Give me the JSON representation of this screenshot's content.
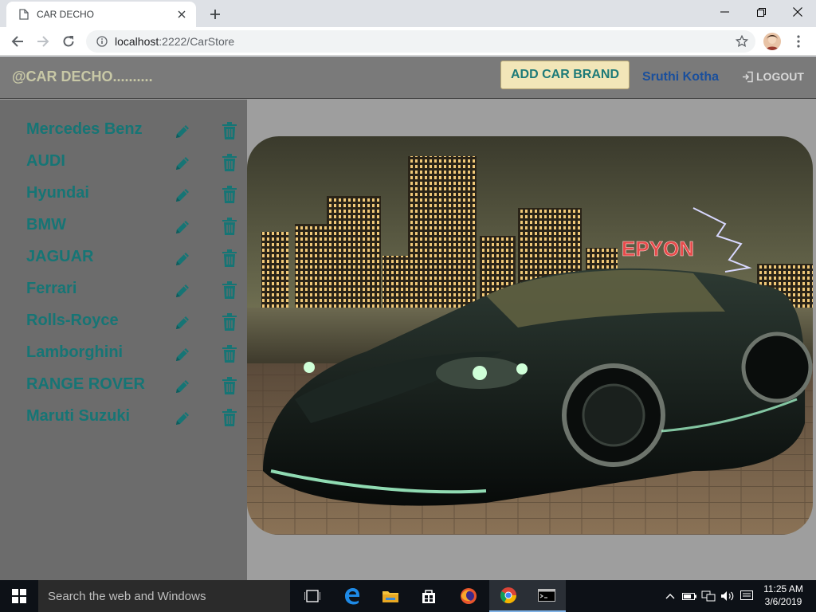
{
  "browser": {
    "tab_title": "CAR DECHO",
    "url_host": "localhost",
    "url_path": ":2222/CarStore"
  },
  "app": {
    "brand": "@CAR DECHO..........",
    "add_button": "ADD CAR BRAND",
    "user_name": "Sruthi Kotha",
    "logout_label": "LOGOUT",
    "car_brands": [
      "Mercedes Benz",
      "AUDI",
      "Hyundai",
      "BMW",
      "JAGUAR",
      "Ferrari",
      "Rolls-Royce",
      "Lamborghini",
      "RANGE ROVER",
      "Maruti Suzuki"
    ],
    "hero_image": {
      "watermark": "EPYON"
    }
  },
  "taskbar": {
    "search_placeholder": "Search the web and Windows",
    "time": "11:25 AM",
    "date": "3/6/2019"
  },
  "colors": {
    "brand_teal": "#167575",
    "header_bg": "#7a7a7a",
    "sidebar_bg": "#6c6c6c",
    "main_bg": "#9e9e9e",
    "add_button_bg": "#f2e6b8",
    "user_name": "#1a4f9c"
  }
}
